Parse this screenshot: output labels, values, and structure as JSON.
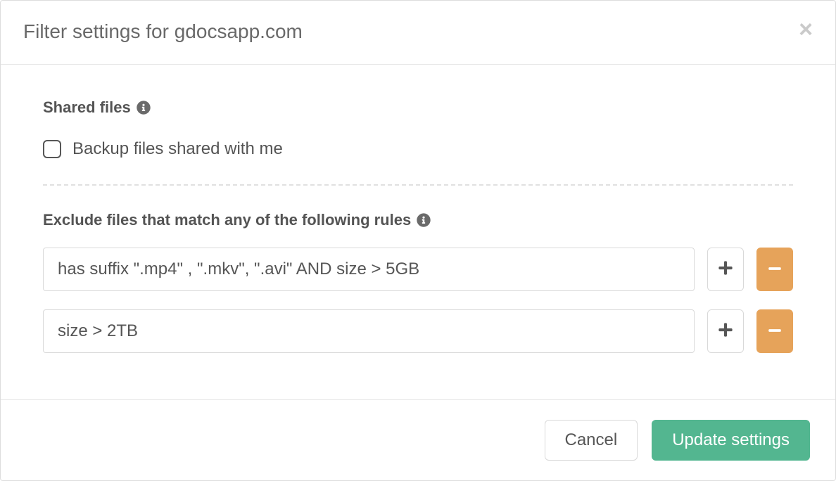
{
  "header": {
    "title": "Filter settings for gdocsapp.com"
  },
  "shared_files": {
    "label": "Shared files",
    "checkbox_label": "Backup files shared with me",
    "checked": false
  },
  "exclude": {
    "label": "Exclude files that match any of the following rules",
    "rules": [
      "has suffix \".mp4\" , \".mkv\", \".avi\" AND size > 5GB",
      "size > 2TB"
    ]
  },
  "footer": {
    "cancel": "Cancel",
    "update": "Update settings"
  }
}
